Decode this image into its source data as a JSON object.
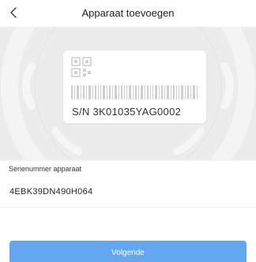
{
  "header": {
    "title": "Apparaat toevoegen",
    "back_icon": "chevron-left-icon"
  },
  "device_card": {
    "serial_text": "S/N  3K01035YAG0002",
    "qr_icon": "qr-code-icon",
    "barcode_icon": "barcode-icon"
  },
  "form": {
    "serial_label": "Serienummer apparaat",
    "serial_value": "4EBK39DN490H064"
  },
  "footer": {
    "next_label": "Volgende"
  },
  "colors": {
    "accent": "#63a7f0",
    "hero_background": "#ececec"
  }
}
